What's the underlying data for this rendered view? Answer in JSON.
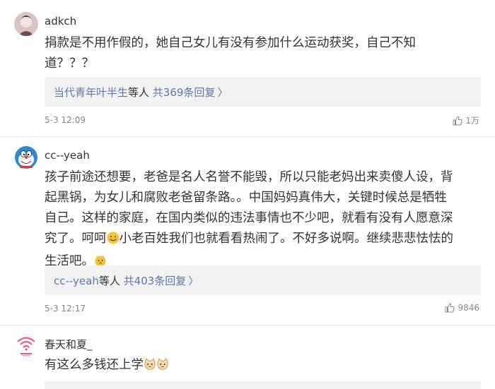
{
  "comments": [
    {
      "username": "adkch",
      "lines": [
        "捐款是不用作假的，她自己女儿有没有参加什么运动获奖，自己不知",
        "道？？？"
      ],
      "reply_users": "当代青年叶半生",
      "reply_mid": "等人 ",
      "reply_count": "共369条回复",
      "time": "5-3 12:09",
      "likes": "1万"
    },
    {
      "username": "cc--yeah",
      "lines": [
        "孩子前途还想要，老爸是名人名誉不能毁，所以只能老妈出来卖傻人设，背",
        "起黑锅，为女儿和腐败老爸留条路。。中国妈妈真伟大，关键时候总是牺牲",
        "自己。这样的家庭，在国内类似的违法事情也不少吧，就看有没有人愿意深",
        "究了。呵呵",
        "小老百姓我们也就看看热闹了。不好多说啊。继续悲悲怯怯的",
        "生活吧。"
      ],
      "reply_users": "cc--yeah",
      "reply_mid": "等人 ",
      "reply_count": "共403条回复",
      "time": "5-3 12:17",
      "likes": "9846"
    },
    {
      "username": "春天和夏_",
      "lines": [
        "有这么多钱还上学"
      ]
    }
  ],
  "chevron": "〉",
  "icons": {
    "like": "thumbs-up-icon",
    "emoji_smile": "smiling-face-icon",
    "emoji_sweat": "sweat-face-icon",
    "emoji_cat": "cat-face-icon",
    "reply_arrow": "chevron-right-icon"
  },
  "colors": {
    "link": "#5b7aa8",
    "reply_bg": "#f2f2f2",
    "meta": "#888888",
    "text": "#333333"
  }
}
